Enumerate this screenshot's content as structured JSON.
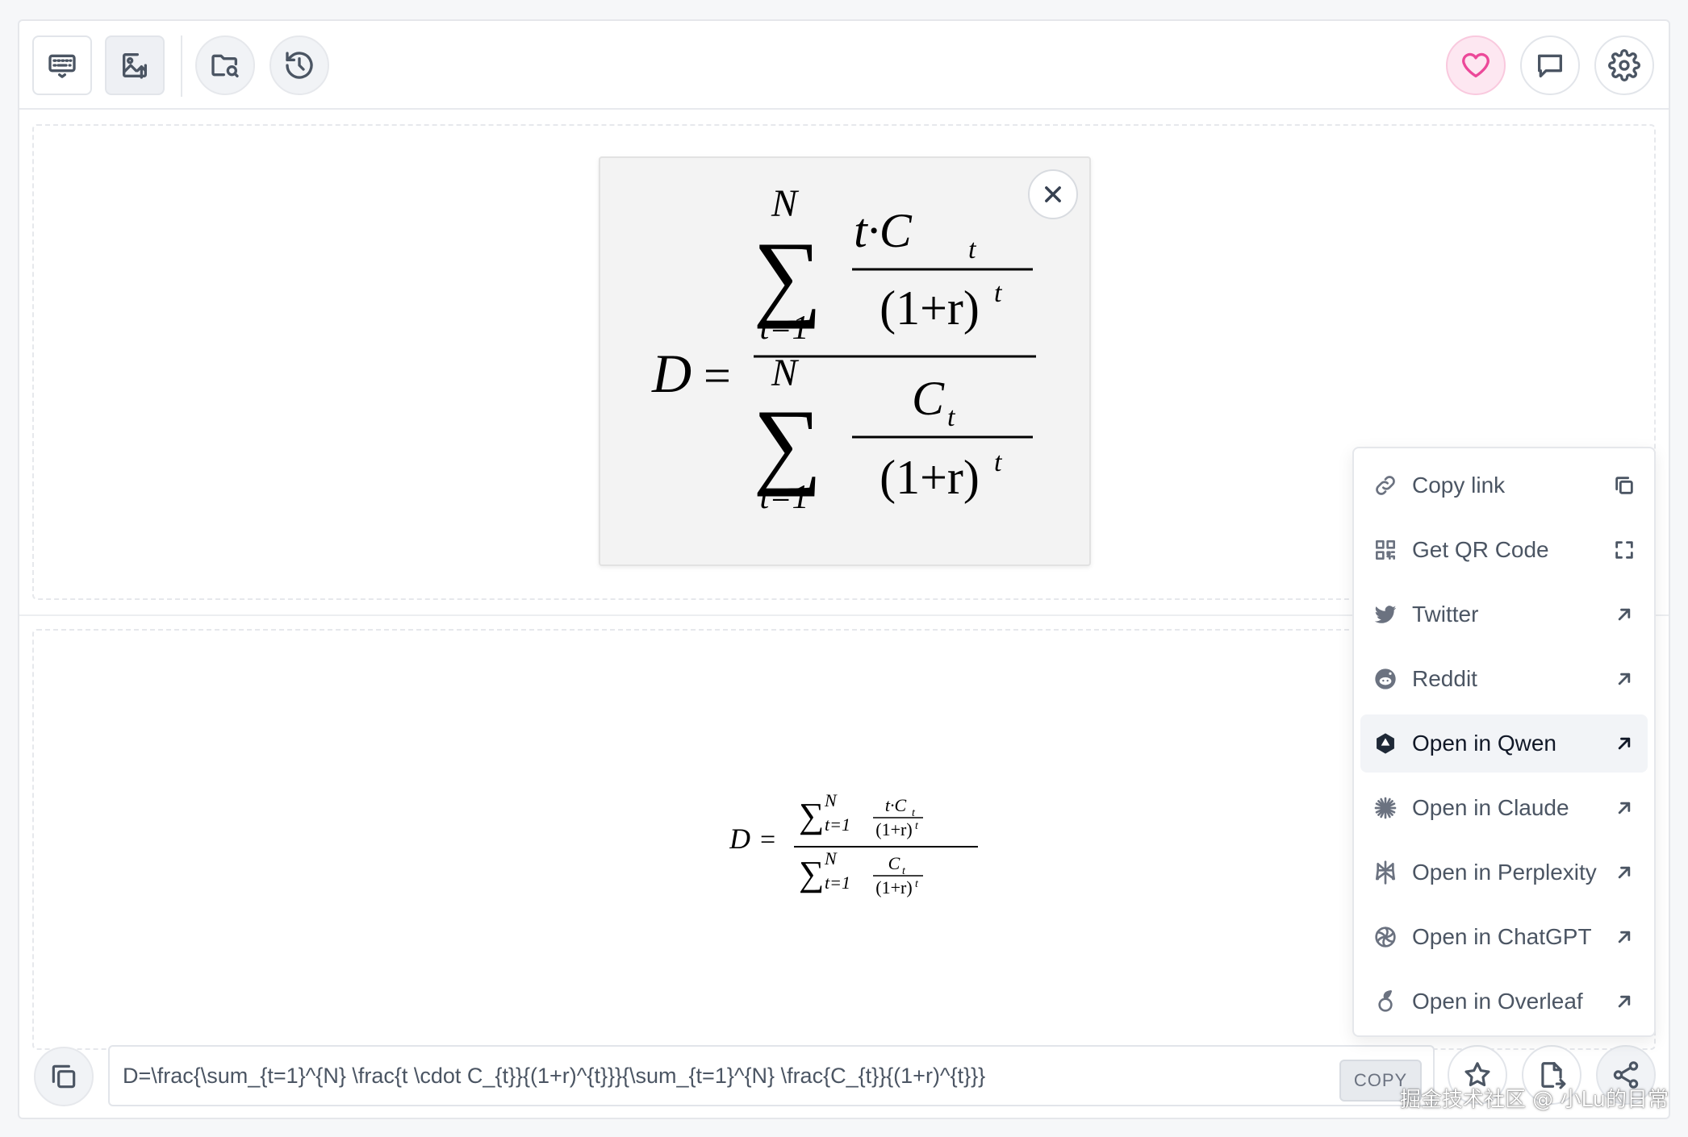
{
  "toolbar": {
    "left_buttons": [
      {
        "name": "keyboard-icon",
        "active": false
      },
      {
        "name": "image-upload-icon",
        "active": true
      },
      {
        "name": "folder-search-icon"
      },
      {
        "name": "history-icon"
      }
    ],
    "right_buttons": [
      "heart-icon",
      "chat-icon",
      "gear-icon"
    ]
  },
  "image_preview": {
    "formula": {
      "lhs": "D",
      "equals": "=",
      "sum_upper": "N",
      "sum_lower": "t=1",
      "num_top": "t·C",
      "num_sub": "t",
      "den": "(1+r)",
      "den_exp": "t",
      "den2_top": "C",
      "den2_sub": "t"
    }
  },
  "rendered_formula": {
    "lhs": "D",
    "equals": "=",
    "sum_upper": "N",
    "sum_lower": "t=1",
    "num_top": "t·C",
    "num_sub": "t",
    "den": "(1+r)",
    "den_exp": "t",
    "den2_top": "C",
    "den2_sub": "t"
  },
  "latex": {
    "value": "D=\\frac{\\sum_{t=1}^{N} \\frac{t \\cdot C_{t}}{(1+r)^{t}}}{\\sum_{t=1}^{N} \\frac{C_{t}}{(1+r)^{t}}}",
    "copy_label": "COPY"
  },
  "share_menu": {
    "items": [
      {
        "label": "Copy link",
        "icon": "link-icon",
        "trail": "copy-icon"
      },
      {
        "label": "Get QR Code",
        "icon": "qr-code-icon",
        "trail": "expand-icon"
      },
      {
        "label": "Twitter",
        "icon": "twitter-icon",
        "trail": "arrow-up-right-icon"
      },
      {
        "label": "Reddit",
        "icon": "reddit-icon",
        "trail": "arrow-up-right-icon"
      },
      {
        "label": "Open in Qwen",
        "icon": "qwen-icon",
        "trail": "arrow-up-right-icon",
        "hover": true
      },
      {
        "label": "Open in Claude",
        "icon": "claude-icon",
        "trail": "arrow-up-right-icon"
      },
      {
        "label": "Open in Perplexity",
        "icon": "perplexity-icon",
        "trail": "arrow-up-right-icon"
      },
      {
        "label": "Open in ChatGPT",
        "icon": "chatgpt-icon",
        "trail": "arrow-up-right-icon"
      },
      {
        "label": "Open in Overleaf",
        "icon": "overleaf-icon",
        "trail": "arrow-up-right-icon"
      }
    ]
  },
  "bottom_buttons": [
    "star-icon",
    "file-export-icon",
    "share-icon"
  ],
  "watermark": "掘金技术社区 @ 小Lu的日常",
  "colors": {
    "accent_pink": "#ec4899",
    "heart_bg": "#fde7f1",
    "menu_hover": "#f2f4f7"
  }
}
